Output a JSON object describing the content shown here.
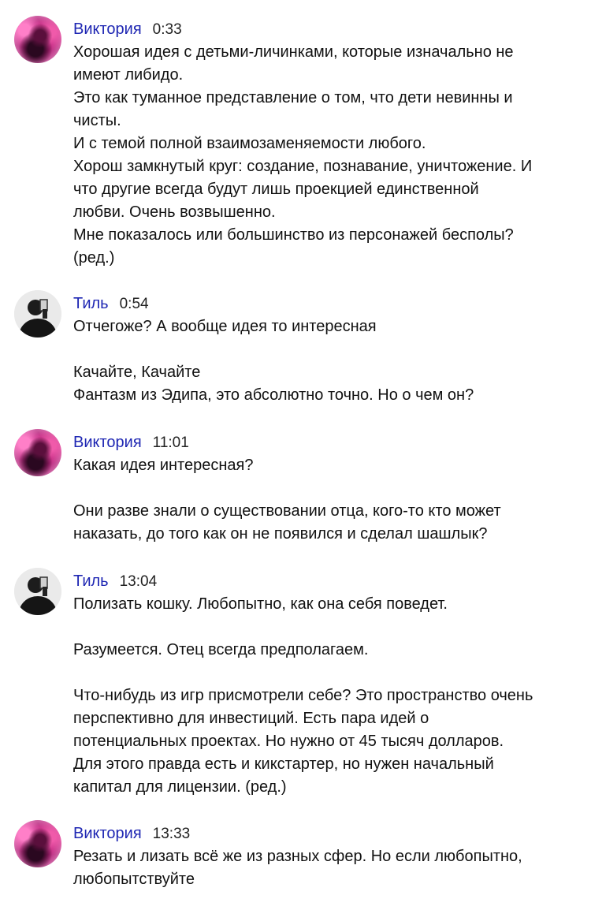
{
  "messages": [
    {
      "author": "Виктория",
      "avatar": "viktoria",
      "time": "0:33",
      "lines": [
        "Хорошая идея с детьми-личинками, которые изначально не",
        "имеют либидо.",
        "Это как туманное представление о том, что дети невинны и",
        "чисты.",
        "И с темой полной взаимозаменяемости любого.",
        "Хорош замкнутый круг: создание, познавание, уничтожение. И",
        "что другие всегда будут лишь проекцией единственной",
        "любви. Очень возвышенно.",
        "Мне показалось или большинство из персонажей бесполы?",
        "(ред.)"
      ]
    },
    {
      "author": "Тиль",
      "avatar": "til",
      "time": "0:54",
      "lines": [
        "Отчегоже? А вообще идея то интересная",
        "",
        "Качайте, Качайте",
        "Фантазм из Эдипа, это абсолютно точно. Но о чем он?"
      ]
    },
    {
      "author": "Виктория",
      "avatar": "viktoria",
      "time": "11:01",
      "lines": [
        "Какая идея интересная?",
        "",
        "Они разве знали о существовании отца, кого-то кто может",
        "наказать, до того как он не появился и сделал шашлык?"
      ]
    },
    {
      "author": "Тиль",
      "avatar": "til",
      "time": "13:04",
      "lines": [
        "Полизать кошку. Любопытно, как она себя поведет.",
        "",
        "Разумеется. Отец всегда предполагаем.",
        "",
        "Что-нибудь из игр присмотрели себе? Это пространство очень",
        "перспективно для инвестиций. Есть пара идей о",
        "потенциальных проектах. Но нужно от 45 тысяч долларов.",
        "Для этого правда есть и кикстартер, но нужен начальный",
        "капитал для лицензии. (ред.)"
      ]
    },
    {
      "author": "Виктория",
      "avatar": "viktoria",
      "time": "13:33",
      "lines": [
        "Резать и лизать всё же из разных сфер. Но если любопытно,",
        "любопытствуйте"
      ]
    }
  ]
}
